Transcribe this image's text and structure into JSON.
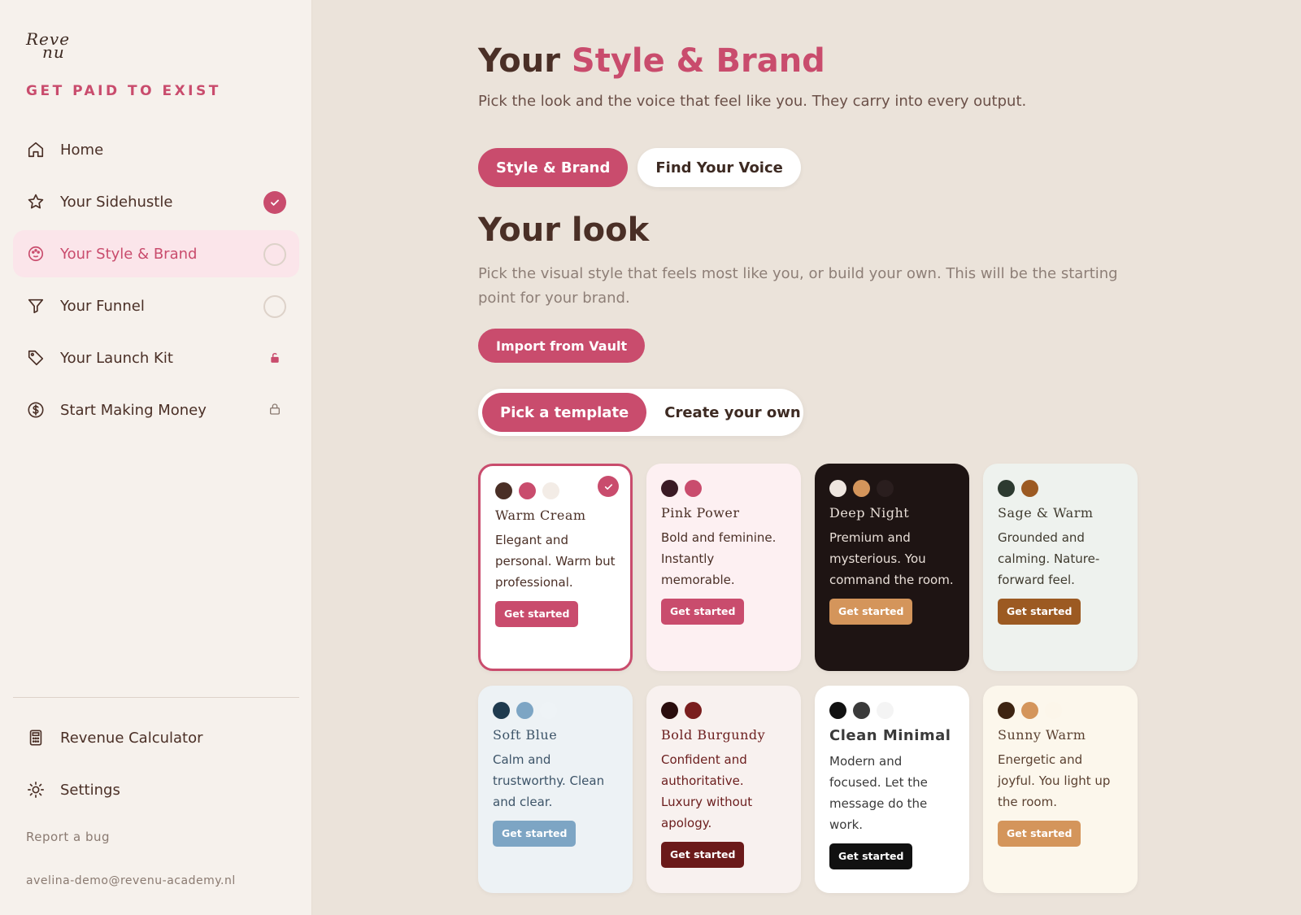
{
  "sidebar": {
    "logo_line1": "Reve",
    "logo_line2": "nu",
    "tagline": "GET PAID TO EXIST",
    "items": [
      {
        "label": "Home"
      },
      {
        "label": "Your Sidehustle"
      },
      {
        "label": "Your Style & Brand"
      },
      {
        "label": "Your Funnel"
      },
      {
        "label": "Your Launch Kit"
      },
      {
        "label": "Start Making Money"
      }
    ],
    "bottom_items": [
      {
        "label": "Revenue Calculator"
      },
      {
        "label": "Settings"
      }
    ],
    "report_bug": "Report a bug",
    "email": "avelina-demo@revenu-academy.nl"
  },
  "main": {
    "title_part1": "Your ",
    "title_part2": "Style & Brand",
    "subtitle": "Pick the look and the voice that feel like you. They carry into every output.",
    "tabs": [
      {
        "label": "Style & Brand"
      },
      {
        "label": "Find Your Voice"
      }
    ],
    "look_title": "Your look",
    "look_subtitle": "Pick the visual style that feels most like you, or build your own. This will be the starting point for your brand.",
    "import_button": "Import from Vault",
    "segments": [
      {
        "label": "Pick a template"
      },
      {
        "label": "Create your own"
      }
    ],
    "templates": [
      {
        "name": "Warm Cream",
        "desc": "Elegant and personal. Warm but professional.",
        "cta": "Get started",
        "colors": [
          "#4a2f26",
          "#c94c6d",
          "#f3ece6"
        ],
        "bg": "#ffffff",
        "text": "#4a2f26",
        "cta_bg": "#c94c6d"
      },
      {
        "name": "Pink Power",
        "desc": "Bold and feminine. Instantly memorable.",
        "cta": "Get started",
        "colors": [
          "#3a1a24",
          "#c94c6d",
          "#fdf0f2"
        ],
        "bg": "#fdf0f2",
        "text": "#4a2f26",
        "cta_bg": "#c94c6d"
      },
      {
        "name": "Deep Night",
        "desc": "Premium and mysterious. You command the room.",
        "cta": "Get started",
        "colors": [
          "#efe6df",
          "#d4955b",
          "#2a1e1e"
        ],
        "bg": "#1e1413",
        "text": "#e9dfd8",
        "cta_bg": "#d4955b"
      },
      {
        "name": "Sage & Warm",
        "desc": "Grounded and calming. Nature-forward feel.",
        "cta": "Get started",
        "colors": [
          "#2d3a30",
          "#9c5a22",
          "#eef2ee"
        ],
        "bg": "#eef2ee",
        "text": "#3f3a2e",
        "cta_bg": "#9c5a22"
      },
      {
        "name": "Soft Blue",
        "desc": "Calm and trustworthy. Clean and clear.",
        "cta": "Get started",
        "colors": [
          "#1f3a4e",
          "#7da5c4",
          "#eef3f6"
        ],
        "bg": "#edf2f5",
        "text": "#3d5468",
        "cta_bg": "#7da5c4"
      },
      {
        "name": "Bold Burgundy",
        "desc": "Confident and authoritative. Luxury without apology.",
        "cta": "Get started",
        "colors": [
          "#2a0d0d",
          "#7a1e1e",
          "#f8f1ef"
        ],
        "bg": "#f8f1ef",
        "text": "#6b1d1d",
        "cta_bg": "#6b1a1a"
      },
      {
        "name": "Clean Minimal",
        "desc": "Modern and focused. Let the message do the work.",
        "cta": "Get started",
        "colors": [
          "#111111",
          "#3a3a3a",
          "#f4f4f4"
        ],
        "bg": "#ffffff",
        "text": "#3a3a3a",
        "cta_bg": "#111111"
      },
      {
        "name": "Sunny Warm",
        "desc": "Energetic and joyful. You light up the room.",
        "cta": "Get started",
        "colors": [
          "#3d2412",
          "#d4955b",
          "#fcf6ea"
        ],
        "bg": "#fcf7ec",
        "text": "#5a4030",
        "cta_bg": "#d4955b"
      }
    ]
  }
}
